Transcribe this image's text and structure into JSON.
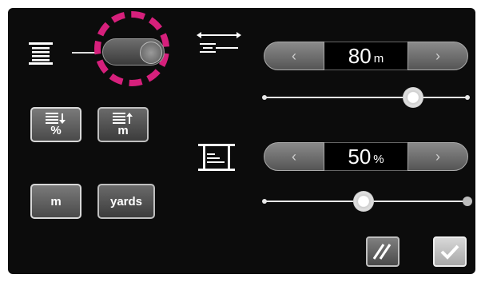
{
  "spool_toggle": {
    "state": "on"
  },
  "length_stepper": {
    "value": "80",
    "unit": "m",
    "slider_fraction": 0.74
  },
  "percent_stepper": {
    "value": "50",
    "unit": "%",
    "slider_fraction": 0.5
  },
  "mode_buttons": {
    "percent_label": "%",
    "meters_label": "m"
  },
  "unit_buttons": {
    "meters_label": "m",
    "yards_label": "yards"
  }
}
